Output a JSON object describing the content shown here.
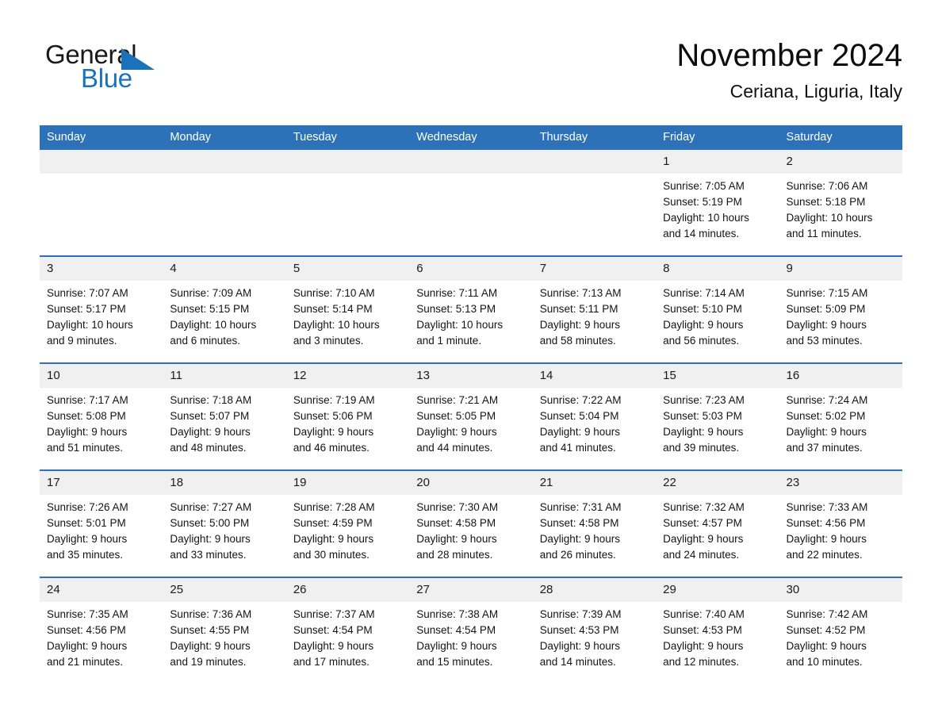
{
  "brand": {
    "name_part1": "General",
    "name_part2": "Blue",
    "accent_color": "#1a72ba"
  },
  "header": {
    "title": "November 2024",
    "subtitle": "Ceriana, Liguria, Italy"
  },
  "theme": {
    "header_blue": "#2d72b8",
    "daynum_band": "#f0f0f0",
    "text": "#141414"
  },
  "weekday_headers": [
    "Sunday",
    "Monday",
    "Tuesday",
    "Wednesday",
    "Thursday",
    "Friday",
    "Saturday"
  ],
  "weeks": [
    [
      {
        "day": "",
        "sunrise": "",
        "sunset": "",
        "daylight1": "",
        "daylight2": "",
        "empty": true
      },
      {
        "day": "",
        "sunrise": "",
        "sunset": "",
        "daylight1": "",
        "daylight2": "",
        "empty": true
      },
      {
        "day": "",
        "sunrise": "",
        "sunset": "",
        "daylight1": "",
        "daylight2": "",
        "empty": true
      },
      {
        "day": "",
        "sunrise": "",
        "sunset": "",
        "daylight1": "",
        "daylight2": "",
        "empty": true
      },
      {
        "day": "",
        "sunrise": "",
        "sunset": "",
        "daylight1": "",
        "daylight2": "",
        "empty": true
      },
      {
        "day": "1",
        "sunrise": "Sunrise: 7:05 AM",
        "sunset": "Sunset: 5:19 PM",
        "daylight1": "Daylight: 10 hours",
        "daylight2": "and 14 minutes."
      },
      {
        "day": "2",
        "sunrise": "Sunrise: 7:06 AM",
        "sunset": "Sunset: 5:18 PM",
        "daylight1": "Daylight: 10 hours",
        "daylight2": "and 11 minutes."
      }
    ],
    [
      {
        "day": "3",
        "sunrise": "Sunrise: 7:07 AM",
        "sunset": "Sunset: 5:17 PM",
        "daylight1": "Daylight: 10 hours",
        "daylight2": "and 9 minutes."
      },
      {
        "day": "4",
        "sunrise": "Sunrise: 7:09 AM",
        "sunset": "Sunset: 5:15 PM",
        "daylight1": "Daylight: 10 hours",
        "daylight2": "and 6 minutes."
      },
      {
        "day": "5",
        "sunrise": "Sunrise: 7:10 AM",
        "sunset": "Sunset: 5:14 PM",
        "daylight1": "Daylight: 10 hours",
        "daylight2": "and 3 minutes."
      },
      {
        "day": "6",
        "sunrise": "Sunrise: 7:11 AM",
        "sunset": "Sunset: 5:13 PM",
        "daylight1": "Daylight: 10 hours",
        "daylight2": "and 1 minute."
      },
      {
        "day": "7",
        "sunrise": "Sunrise: 7:13 AM",
        "sunset": "Sunset: 5:11 PM",
        "daylight1": "Daylight: 9 hours",
        "daylight2": "and 58 minutes."
      },
      {
        "day": "8",
        "sunrise": "Sunrise: 7:14 AM",
        "sunset": "Sunset: 5:10 PM",
        "daylight1": "Daylight: 9 hours",
        "daylight2": "and 56 minutes."
      },
      {
        "day": "9",
        "sunrise": "Sunrise: 7:15 AM",
        "sunset": "Sunset: 5:09 PM",
        "daylight1": "Daylight: 9 hours",
        "daylight2": "and 53 minutes."
      }
    ],
    [
      {
        "day": "10",
        "sunrise": "Sunrise: 7:17 AM",
        "sunset": "Sunset: 5:08 PM",
        "daylight1": "Daylight: 9 hours",
        "daylight2": "and 51 minutes."
      },
      {
        "day": "11",
        "sunrise": "Sunrise: 7:18 AM",
        "sunset": "Sunset: 5:07 PM",
        "daylight1": "Daylight: 9 hours",
        "daylight2": "and 48 minutes."
      },
      {
        "day": "12",
        "sunrise": "Sunrise: 7:19 AM",
        "sunset": "Sunset: 5:06 PM",
        "daylight1": "Daylight: 9 hours",
        "daylight2": "and 46 minutes."
      },
      {
        "day": "13",
        "sunrise": "Sunrise: 7:21 AM",
        "sunset": "Sunset: 5:05 PM",
        "daylight1": "Daylight: 9 hours",
        "daylight2": "and 44 minutes."
      },
      {
        "day": "14",
        "sunrise": "Sunrise: 7:22 AM",
        "sunset": "Sunset: 5:04 PM",
        "daylight1": "Daylight: 9 hours",
        "daylight2": "and 41 minutes."
      },
      {
        "day": "15",
        "sunrise": "Sunrise: 7:23 AM",
        "sunset": "Sunset: 5:03 PM",
        "daylight1": "Daylight: 9 hours",
        "daylight2": "and 39 minutes."
      },
      {
        "day": "16",
        "sunrise": "Sunrise: 7:24 AM",
        "sunset": "Sunset: 5:02 PM",
        "daylight1": "Daylight: 9 hours",
        "daylight2": "and 37 minutes."
      }
    ],
    [
      {
        "day": "17",
        "sunrise": "Sunrise: 7:26 AM",
        "sunset": "Sunset: 5:01 PM",
        "daylight1": "Daylight: 9 hours",
        "daylight2": "and 35 minutes."
      },
      {
        "day": "18",
        "sunrise": "Sunrise: 7:27 AM",
        "sunset": "Sunset: 5:00 PM",
        "daylight1": "Daylight: 9 hours",
        "daylight2": "and 33 minutes."
      },
      {
        "day": "19",
        "sunrise": "Sunrise: 7:28 AM",
        "sunset": "Sunset: 4:59 PM",
        "daylight1": "Daylight: 9 hours",
        "daylight2": "and 30 minutes."
      },
      {
        "day": "20",
        "sunrise": "Sunrise: 7:30 AM",
        "sunset": "Sunset: 4:58 PM",
        "daylight1": "Daylight: 9 hours",
        "daylight2": "and 28 minutes."
      },
      {
        "day": "21",
        "sunrise": "Sunrise: 7:31 AM",
        "sunset": "Sunset: 4:58 PM",
        "daylight1": "Daylight: 9 hours",
        "daylight2": "and 26 minutes."
      },
      {
        "day": "22",
        "sunrise": "Sunrise: 7:32 AM",
        "sunset": "Sunset: 4:57 PM",
        "daylight1": "Daylight: 9 hours",
        "daylight2": "and 24 minutes."
      },
      {
        "day": "23",
        "sunrise": "Sunrise: 7:33 AM",
        "sunset": "Sunset: 4:56 PM",
        "daylight1": "Daylight: 9 hours",
        "daylight2": "and 22 minutes."
      }
    ],
    [
      {
        "day": "24",
        "sunrise": "Sunrise: 7:35 AM",
        "sunset": "Sunset: 4:56 PM",
        "daylight1": "Daylight: 9 hours",
        "daylight2": "and 21 minutes."
      },
      {
        "day": "25",
        "sunrise": "Sunrise: 7:36 AM",
        "sunset": "Sunset: 4:55 PM",
        "daylight1": "Daylight: 9 hours",
        "daylight2": "and 19 minutes."
      },
      {
        "day": "26",
        "sunrise": "Sunrise: 7:37 AM",
        "sunset": "Sunset: 4:54 PM",
        "daylight1": "Daylight: 9 hours",
        "daylight2": "and 17 minutes."
      },
      {
        "day": "27",
        "sunrise": "Sunrise: 7:38 AM",
        "sunset": "Sunset: 4:54 PM",
        "daylight1": "Daylight: 9 hours",
        "daylight2": "and 15 minutes."
      },
      {
        "day": "28",
        "sunrise": "Sunrise: 7:39 AM",
        "sunset": "Sunset: 4:53 PM",
        "daylight1": "Daylight: 9 hours",
        "daylight2": "and 14 minutes."
      },
      {
        "day": "29",
        "sunrise": "Sunrise: 7:40 AM",
        "sunset": "Sunset: 4:53 PM",
        "daylight1": "Daylight: 9 hours",
        "daylight2": "and 12 minutes."
      },
      {
        "day": "30",
        "sunrise": "Sunrise: 7:42 AM",
        "sunset": "Sunset: 4:52 PM",
        "daylight1": "Daylight: 9 hours",
        "daylight2": "and 10 minutes."
      }
    ]
  ]
}
